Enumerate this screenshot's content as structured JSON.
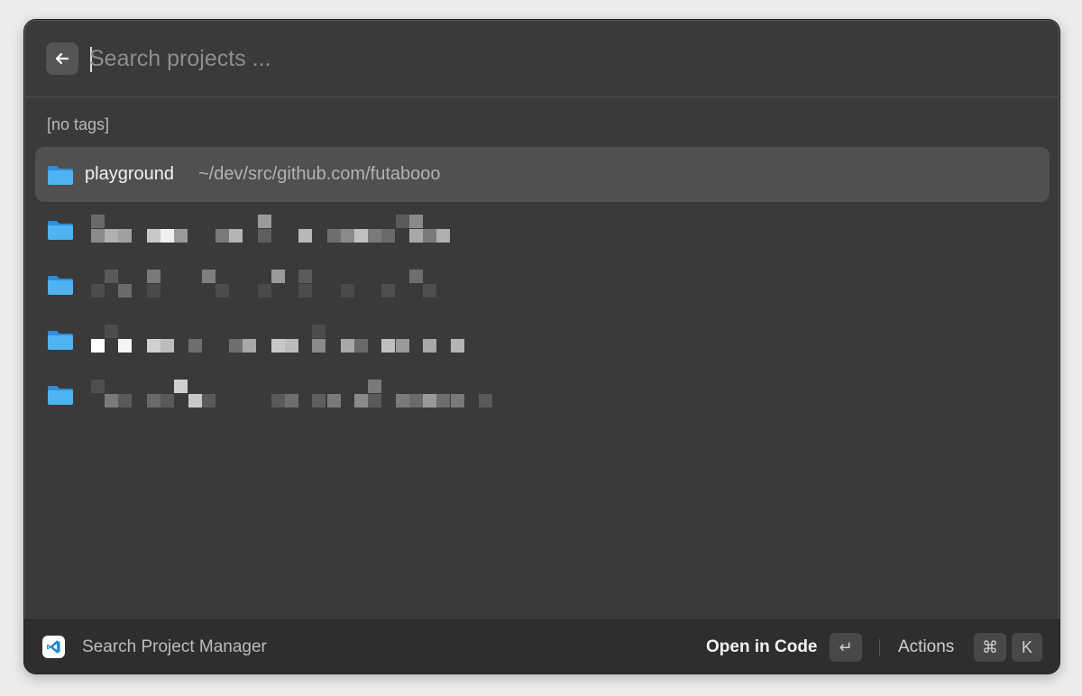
{
  "search": {
    "placeholder": "Search projects ...",
    "value": ""
  },
  "section_label": "[no tags]",
  "items": [
    {
      "title": "playground",
      "subtitle": "~/dev/src/github.com/futabooo",
      "selected": true,
      "icon": "folder-icon"
    },
    {
      "title": "",
      "subtitle": "",
      "selected": false,
      "icon": "folder-icon",
      "redacted": true
    },
    {
      "title": "",
      "subtitle": "",
      "selected": false,
      "icon": "folder-icon",
      "redacted": true
    },
    {
      "title": "",
      "subtitle": "",
      "selected": false,
      "icon": "folder-icon",
      "redacted": true
    },
    {
      "title": "",
      "subtitle": "",
      "selected": false,
      "icon": "folder-icon",
      "redacted": true
    }
  ],
  "footer": {
    "app_icon": "vscode-icon",
    "title": "Search Project Manager",
    "primary_action": "Open in Code",
    "primary_shortcut": "↵",
    "actions_label": "Actions",
    "actions_shortcut": [
      "⌘",
      "K"
    ]
  },
  "colors": {
    "window_bg": "#3a3a3a",
    "selected_row": "#505050",
    "folder_blue": "#3ea6ec",
    "vscode_blue": "#1f8ad2"
  }
}
